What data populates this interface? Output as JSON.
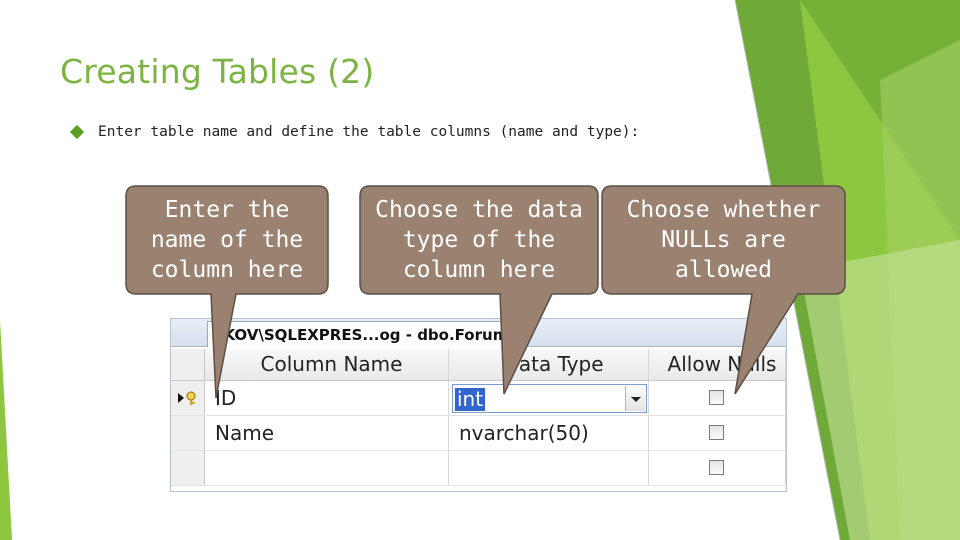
{
  "slide": {
    "title": "Creating Tables (2)",
    "bullet": "Enter table name  and define the table columns (name and type):"
  },
  "callouts": {
    "name": {
      "lines": [
        "Enter the",
        "name of the",
        "column here"
      ]
    },
    "type": {
      "lines": [
        "Choose the data",
        "type of the",
        "column here"
      ]
    },
    "nulls": {
      "lines": [
        "Choose whether",
        "NULLs are",
        "allowed"
      ]
    }
  },
  "designer": {
    "tab_title": "\\KOV\\SQLEXPRES...og - dbo.Forums*",
    "columns": [
      "Column Name",
      "Data Type",
      "Allow Nulls"
    ],
    "rows": [
      {
        "name": "ID",
        "type": "int",
        "allow_nulls": false,
        "current": true
      },
      {
        "name": "Name",
        "type": "nvarchar(50)",
        "allow_nulls": false,
        "current": false
      },
      {
        "name": "",
        "type": "",
        "allow_nulls": false,
        "current": false
      }
    ]
  },
  "colors": {
    "title": "#7cb342",
    "accent_green": "#8dc63f",
    "dark_green": "#5a9e24",
    "callout_fill": "#9b8270",
    "callout_border": "#5c4f45",
    "selection": "#3366cc"
  }
}
